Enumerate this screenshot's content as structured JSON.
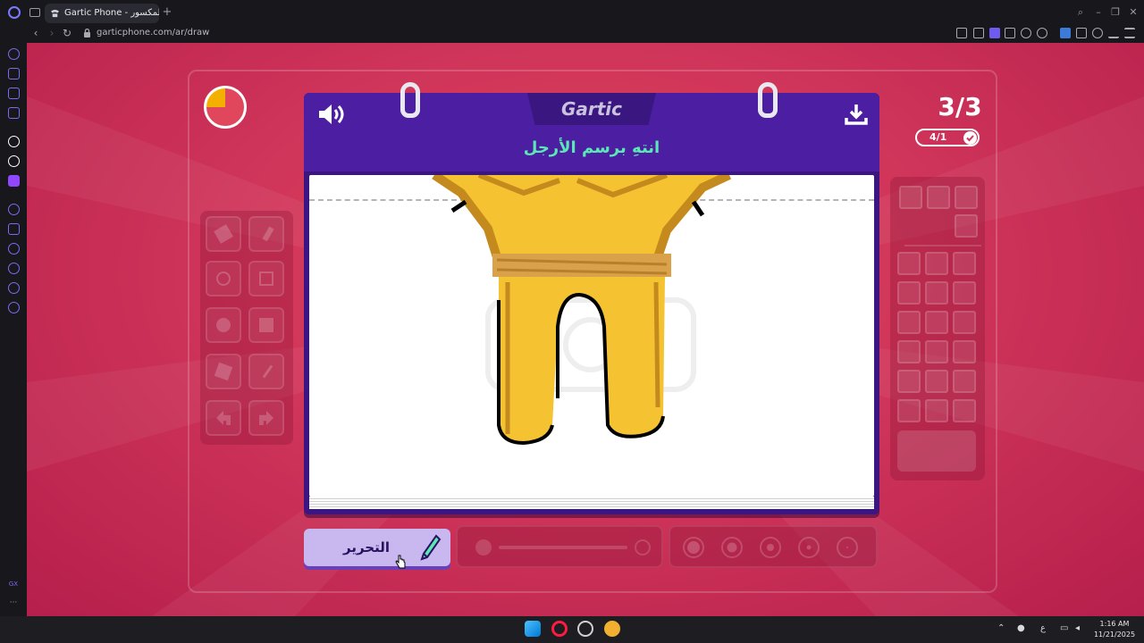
{
  "browser": {
    "tab_title": "Gartic Phone - الهاتف المكسور",
    "new_tab": "+",
    "url": "garticphone.com/ar/draw",
    "nav": {
      "back": "‹",
      "forward": "›",
      "reload": "↻"
    },
    "window_controls": {
      "search": "⌕",
      "minimize": "–",
      "restore": "❐",
      "close": "✕"
    }
  },
  "sidebar": {
    "items": [
      "speed-dial",
      "aria",
      "wallet",
      "messenger",
      "aria-ai",
      "chatgpt",
      "twitch",
      "player",
      "workspaces",
      "bookmarks",
      "history",
      "extensions",
      "settings"
    ],
    "bottom_label": "GX",
    "more_label": "···"
  },
  "game": {
    "timer_remaining_fraction": 0.25,
    "round_counter": "3/3",
    "players_done": "4/1",
    "logo": "Gartic",
    "prompt": "انتهِ برسم الأرجل",
    "edit_button": "التحرير",
    "colors": {
      "accent_purple": "#4b1ea2",
      "prompt_green": "#5ce8b6",
      "background_red": "#d0355a",
      "drawing_yellow": "#f5c332"
    }
  },
  "tools": [
    "eraser",
    "pencil",
    "circle-outline",
    "square-outline",
    "circle-fill",
    "square-fill",
    "bucket",
    "line",
    "undo",
    "redo"
  ],
  "taskbar": {
    "keyboard_lang": "ع",
    "time": "1:16 AM",
    "date": "11/21/2025",
    "icons": [
      "windows-start",
      "opera-gx",
      "chrome-beta",
      "discord"
    ]
  }
}
